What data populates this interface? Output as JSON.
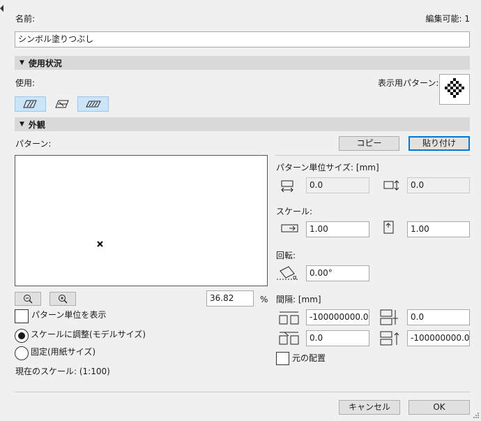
{
  "header": {
    "name_label": "名前:",
    "editable_label": "編集可能: 1"
  },
  "name_field": {
    "value": "シンボル塗りつぶし"
  },
  "usage_section": {
    "title": "使用状況",
    "usage_label": "使用:",
    "display_pattern_label": "表示用パターン:",
    "toggles": [
      {
        "name": "cut-fill",
        "selected": true
      },
      {
        "name": "cover-fill",
        "selected": false
      },
      {
        "name": "drafting-fill",
        "selected": true
      }
    ]
  },
  "appearance_section": {
    "title": "外観",
    "pattern_label": "パターン:",
    "copy_button": "コピー",
    "paste_button": "貼り付け",
    "zoom_value": "36.82",
    "zoom_unit": "%",
    "show_pattern_unit_label": "パターン単位を表示",
    "scale_model_label": "スケールに調整(モデルサイズ)",
    "fixed_paper_label": "固定(用紙サイズ)",
    "current_scale_label": "現在のスケール: (1:100)",
    "pattern_unit_size_label": "パターン単位サイズ: [mm]",
    "unit_width_value": "0.0",
    "unit_height_value": "0.0",
    "scale_label": "スケール:",
    "scale_x_value": "1.00",
    "scale_y_value": "1.00",
    "rotation_label": "回転:",
    "rotation_value": "0.00°",
    "spacing_label": "間隔: [mm]",
    "spacing_1_value": "-100000000.0",
    "spacing_2_value": "0.0",
    "spacing_3_value": "0.0",
    "spacing_4_value": "-100000000.0",
    "original_origin_label": "元の配置"
  },
  "footer": {
    "cancel_button": "キャンセル",
    "ok_button": "OK"
  },
  "colors": {
    "accent": "#0078d7",
    "toggle_selected": "#cce4f7",
    "section_bar": "#d9d9d9"
  }
}
